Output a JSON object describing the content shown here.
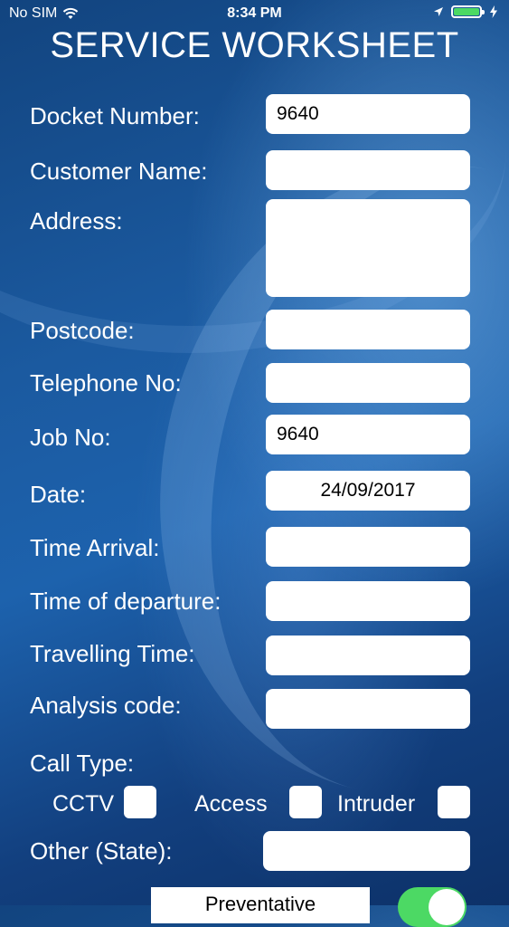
{
  "status_bar": {
    "carrier": "No SIM",
    "time": "8:34 PM",
    "icons": [
      "wifi-icon",
      "location-arrow-icon",
      "battery-icon",
      "charging-bolt-icon"
    ]
  },
  "title": "SERVICE WORKSHEET",
  "fields": {
    "docket_number": {
      "label": "Docket Number:",
      "value": "9640"
    },
    "customer_name": {
      "label": "Customer Name:",
      "value": ""
    },
    "address": {
      "label": "Address:",
      "value": ""
    },
    "postcode": {
      "label": "Postcode:",
      "value": ""
    },
    "telephone": {
      "label": "Telephone No:",
      "value": ""
    },
    "job_no": {
      "label": "Job No:",
      "value": "9640"
    },
    "date": {
      "label": "Date:",
      "value": "24/09/2017"
    },
    "time_arrival": {
      "label": "Time Arrival:",
      "value": ""
    },
    "time_departure": {
      "label": "Time of departure:",
      "value": ""
    },
    "travelling_time": {
      "label": "Travelling Time:",
      "value": ""
    },
    "analysis_code": {
      "label": "Analysis code:",
      "value": ""
    },
    "other_state": {
      "label": "Other (State):",
      "value": ""
    }
  },
  "call_type": {
    "label": "Call Type:",
    "options": [
      "CCTV",
      "Access",
      "Intruder"
    ]
  },
  "preventative_button": "Preventative",
  "colors": {
    "toggle_on": "#4cd964",
    "background": "#1b5aa0"
  }
}
